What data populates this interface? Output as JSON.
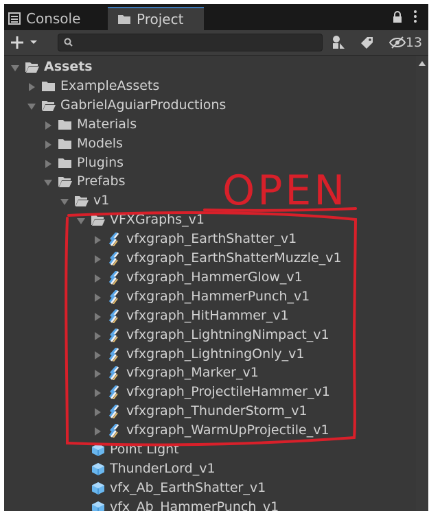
{
  "tabs": {
    "console": "Console",
    "project": "Project"
  },
  "toolbar": {
    "create_icon": "plus-dropdown-icon",
    "search_icon": "search-icon",
    "search_placeholder": "",
    "search_by_type_icon": "search-by-type-icon",
    "search_by_label_icon": "label-tag-icon",
    "hidden_packages_count": "13"
  },
  "annotation": {
    "text": "OPEN",
    "color": "#d8202a"
  },
  "tree": [
    {
      "label": "Assets",
      "depth": 0,
      "expanded": true,
      "kind": "folder",
      "bold": true
    },
    {
      "label": "ExampleAssets",
      "depth": 1,
      "expanded": false,
      "kind": "folder"
    },
    {
      "label": "GabrielAguiarProductions",
      "depth": 1,
      "expanded": true,
      "kind": "folder"
    },
    {
      "label": "Materials",
      "depth": 2,
      "expanded": false,
      "kind": "folder"
    },
    {
      "label": "Models",
      "depth": 2,
      "expanded": false,
      "kind": "folder"
    },
    {
      "label": "Plugins",
      "depth": 2,
      "expanded": false,
      "kind": "folder"
    },
    {
      "label": "Prefabs",
      "depth": 2,
      "expanded": true,
      "kind": "folder"
    },
    {
      "label": "v1",
      "depth": 3,
      "expanded": true,
      "kind": "folder"
    },
    {
      "label": "VFXGraphs_v1",
      "depth": 4,
      "expanded": true,
      "kind": "folder"
    },
    {
      "label": "vfxgraph_EarthShatter_v1",
      "depth": 5,
      "expanded": false,
      "kind": "vfx"
    },
    {
      "label": "vfxgraph_EarthShatterMuzzle_v1",
      "depth": 5,
      "expanded": false,
      "kind": "vfx"
    },
    {
      "label": "vfxgraph_HammerGlow_v1",
      "depth": 5,
      "expanded": false,
      "kind": "vfx"
    },
    {
      "label": "vfxgraph_HammerPunch_v1",
      "depth": 5,
      "expanded": false,
      "kind": "vfx"
    },
    {
      "label": "vfxgraph_HitHammer_v1",
      "depth": 5,
      "expanded": false,
      "kind": "vfx"
    },
    {
      "label": "vfxgraph_LightningNimpact_v1",
      "depth": 5,
      "expanded": false,
      "kind": "vfx"
    },
    {
      "label": "vfxgraph_LightningOnly_v1",
      "depth": 5,
      "expanded": false,
      "kind": "vfx"
    },
    {
      "label": "vfxgraph_Marker_v1",
      "depth": 5,
      "expanded": false,
      "kind": "vfx"
    },
    {
      "label": "vfxgraph_ProjectileHammer_v1",
      "depth": 5,
      "expanded": false,
      "kind": "vfx"
    },
    {
      "label": "vfxgraph_ThunderStorm_v1",
      "depth": 5,
      "expanded": false,
      "kind": "vfx"
    },
    {
      "label": "vfxgraph_WarmUpProjectile_v1",
      "depth": 5,
      "expanded": false,
      "kind": "vfx"
    },
    {
      "label": "Point Light",
      "depth": 4,
      "expanded": null,
      "kind": "prefab"
    },
    {
      "label": "ThunderLord_v1",
      "depth": 4,
      "expanded": null,
      "kind": "prefab"
    },
    {
      "label": "vfx_Ab_EarthShatter_v1",
      "depth": 4,
      "expanded": null,
      "kind": "prefab"
    },
    {
      "label": "vfx_Ab_HammerPunch_v1",
      "depth": 4,
      "expanded": null,
      "kind": "prefab"
    }
  ]
}
